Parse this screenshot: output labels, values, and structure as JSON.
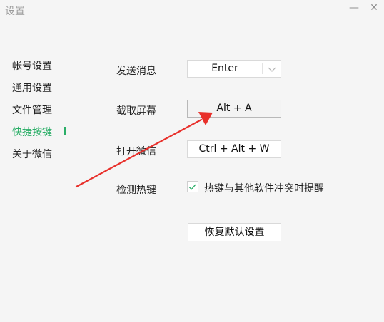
{
  "window": {
    "title": "设置",
    "minimize_glyph": "—",
    "close_glyph": "✕"
  },
  "sidebar": {
    "items": [
      {
        "label": "帐号设置",
        "active": false
      },
      {
        "label": "通用设置",
        "active": false
      },
      {
        "label": "文件管理",
        "active": false
      },
      {
        "label": "快捷按键",
        "active": true
      },
      {
        "label": "关于微信",
        "active": false
      }
    ]
  },
  "shortcuts": {
    "send_message": {
      "label": "发送消息",
      "value": "Enter"
    },
    "screenshot": {
      "label": "截取屏幕",
      "value": "Alt + A"
    },
    "open_wechat": {
      "label": "打开微信",
      "value": "Ctrl + Alt + W"
    },
    "detect_hotkey": {
      "label": "检测热键",
      "checkbox_label": "热键与其他软件冲突时提醒",
      "checked": true
    }
  },
  "restore_button": "恢复默认设置",
  "colors": {
    "accent": "#2aae67",
    "annotation_arrow": "#e8302b"
  },
  "icons": {
    "dropdown": "chevron-down-icon",
    "checkmark": "checkmark-icon",
    "annotation": "red-arrow-icon"
  }
}
